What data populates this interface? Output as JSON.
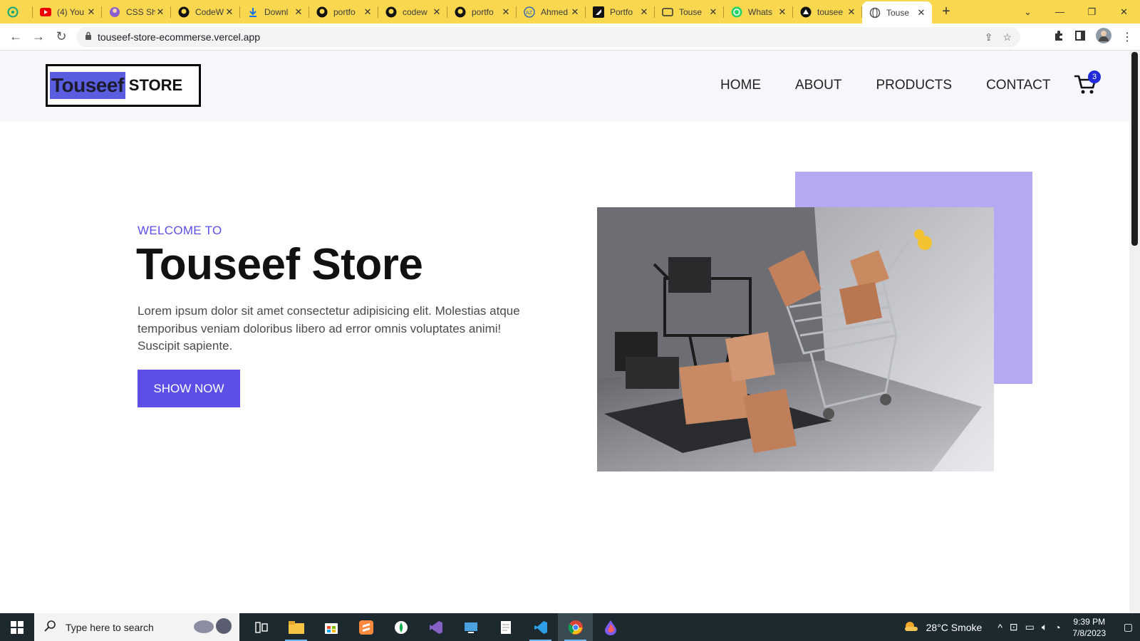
{
  "browser": {
    "tabs": [
      {
        "title": "",
        "icon": "chatgpt-icon"
      },
      {
        "title": "(4) You",
        "icon": "youtube-icon"
      },
      {
        "title": "CSS Sh",
        "icon": "avatar-icon"
      },
      {
        "title": "CodeW",
        "icon": "github-icon"
      },
      {
        "title": "Downl",
        "icon": "download-icon"
      },
      {
        "title": "portfo",
        "icon": "github-icon"
      },
      {
        "title": "codew",
        "icon": "github-icon"
      },
      {
        "title": "portfo",
        "icon": "github-icon"
      },
      {
        "title": "Ahmed",
        "icon": "az-icon"
      },
      {
        "title": "Portfo",
        "icon": "framer-icon"
      },
      {
        "title": "Touse",
        "icon": "app-icon"
      },
      {
        "title": "Whats",
        "icon": "whatsapp-icon"
      },
      {
        "title": "tousee",
        "icon": "vercel-icon"
      },
      {
        "title": "Touse",
        "icon": "globe-icon"
      }
    ],
    "url": "touseef-store-ecommerse.vercel.app"
  },
  "site": {
    "logo": {
      "brand": "Touseef",
      "suffix": "STORE"
    },
    "nav": [
      "HOME",
      "ABOUT",
      "PRODUCTS",
      "CONTACT"
    ],
    "cart_count": "3"
  },
  "hero": {
    "subtitle": "WELCOME TO",
    "title": "Touseef Store",
    "text": "Lorem ipsum dolor sit amet consectetur adipisicing elit. Molestias atque temporibus veniam doloribus libero ad error omnis voluptates animi! Suscipit sapiente.",
    "button": "SHOW NOW"
  },
  "taskbar": {
    "search_placeholder": "Type here to search",
    "weather": "28°C  Smoke",
    "time": "9:39 PM",
    "date": "7/8/2023"
  },
  "colors": {
    "accent": "#5b4fe8",
    "accent_light": "#b4aaf3",
    "tabstrip": "#f9d74f"
  }
}
